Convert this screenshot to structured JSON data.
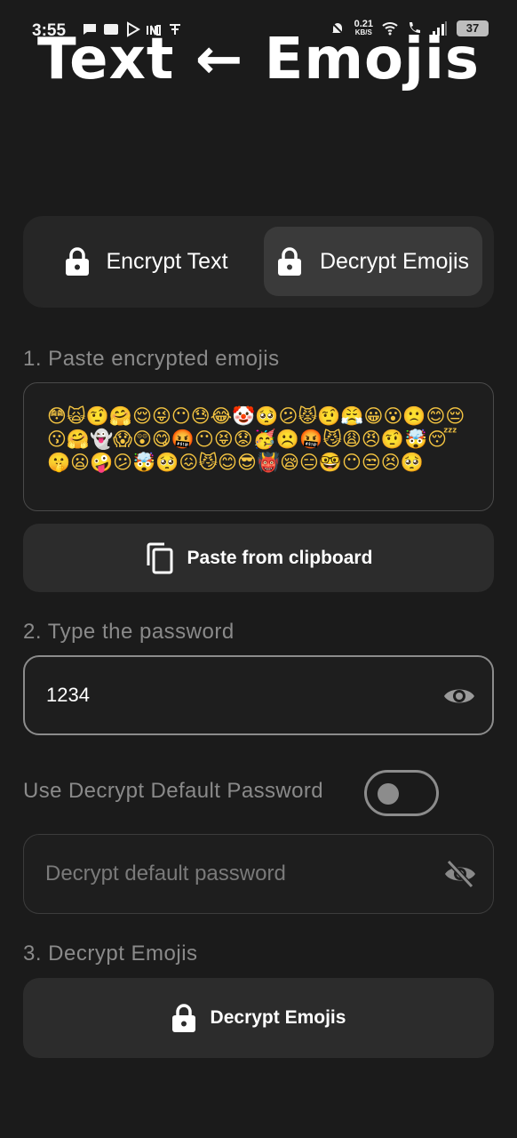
{
  "status_bar": {
    "time": "3:55",
    "net_speed_value": "0.21",
    "net_speed_unit": "KB/S",
    "battery": "37"
  },
  "title": "Text ← Emojis",
  "tabs": [
    {
      "label": "Encrypt Text",
      "active": false
    },
    {
      "label": "Decrypt Emojis",
      "active": true
    }
  ],
  "step1": {
    "label": "1. Paste encrypted emojis",
    "emojis": "😳🙀🤨🤗😌😜😶😓😂🤡🥺😕😾🤨😤😀😮🙁😊😔😗🤗👻😱😲😋🤬😶😝😟🥳☹️🤬😼😩😠🤨🤯😴🤫😦🤪😕🤯🥺😖😼😊😎👹😪😑🤓😶😒😣🥺",
    "paste_button": "Paste from clipboard"
  },
  "step2": {
    "label": "2. Type the password",
    "password_value": "1234"
  },
  "default_password": {
    "toggle_label": "Use Decrypt Default Password",
    "toggle_on": false,
    "placeholder": "Decrypt default password"
  },
  "step3": {
    "label": "3. Decrypt Emojis",
    "button": "Decrypt Emojis"
  },
  "colors": {
    "background": "#1b1b1b",
    "surface": "#262626",
    "active_tab": "#3a3a3a",
    "muted_text": "#8a8a8a"
  }
}
